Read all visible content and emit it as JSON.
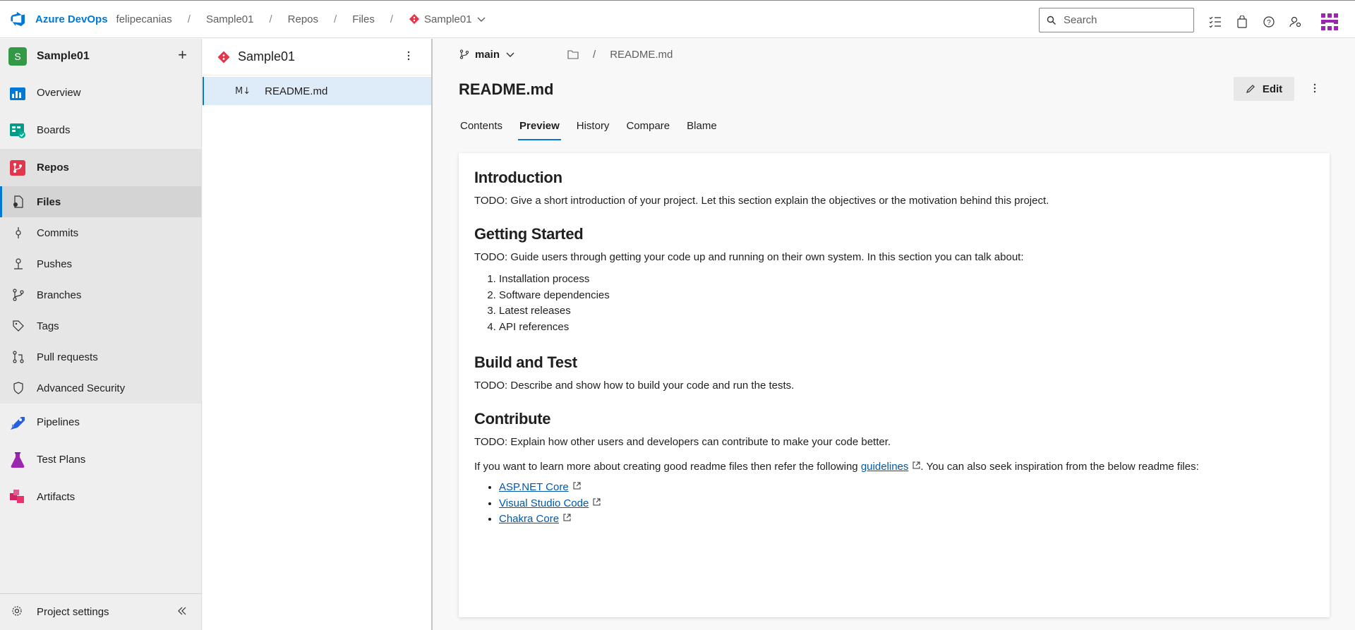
{
  "topbar": {
    "brand": "Azure DevOps",
    "breadcrumbs": [
      "felipecanias",
      "Sample01",
      "Repos",
      "Files"
    ],
    "repo": "Sample01",
    "search_placeholder": "Search"
  },
  "leftnav": {
    "project_initial": "S",
    "project_name": "Sample01",
    "items": [
      {
        "label": "Overview"
      },
      {
        "label": "Boards"
      },
      {
        "label": "Repos"
      }
    ],
    "repo_subitems": [
      {
        "label": "Files"
      },
      {
        "label": "Commits"
      },
      {
        "label": "Pushes"
      },
      {
        "label": "Branches"
      },
      {
        "label": "Tags"
      },
      {
        "label": "Pull requests"
      },
      {
        "label": "Advanced Security"
      }
    ],
    "bottom_items": [
      {
        "label": "Pipelines"
      },
      {
        "label": "Test Plans"
      },
      {
        "label": "Artifacts"
      }
    ],
    "footer_label": "Project settings"
  },
  "filepanel": {
    "repo_name": "Sample01",
    "file_icon": "M↓",
    "selected_file": "README.md"
  },
  "main": {
    "branch": "main",
    "path_file": "README.md",
    "title": "README.md",
    "edit_label": "Edit",
    "tabs": [
      "Contents",
      "Preview",
      "History",
      "Compare",
      "Blame"
    ],
    "active_tab": "Preview"
  },
  "readme": {
    "intro_heading": "Introduction",
    "intro_text": "TODO: Give a short introduction of your project. Let this section explain the objectives or the motivation behind this project.",
    "gs_heading": "Getting Started",
    "gs_text": "TODO: Guide users through getting your code up and running on their own system. In this section you can talk about:",
    "gs_list": [
      "Installation process",
      "Software dependencies",
      "Latest releases",
      "API references"
    ],
    "bt_heading": "Build and Test",
    "bt_text": "TODO: Describe and show how to build your code and run the tests.",
    "contrib_heading": "Contribute",
    "contrib_text": "TODO: Explain how other users and developers can contribute to make your code better.",
    "more_text_before": "If you want to learn more about creating good readme files then refer the following ",
    "more_link": "guidelines",
    "more_text_after": ". You can also seek inspiration from the below readme files:",
    "links": [
      "ASP.NET Core",
      "Visual Studio Code",
      "Chakra Core"
    ]
  },
  "colors": {
    "accent": "#0078d4",
    "repo_red": "#e3364a",
    "project_green": "#339947"
  }
}
